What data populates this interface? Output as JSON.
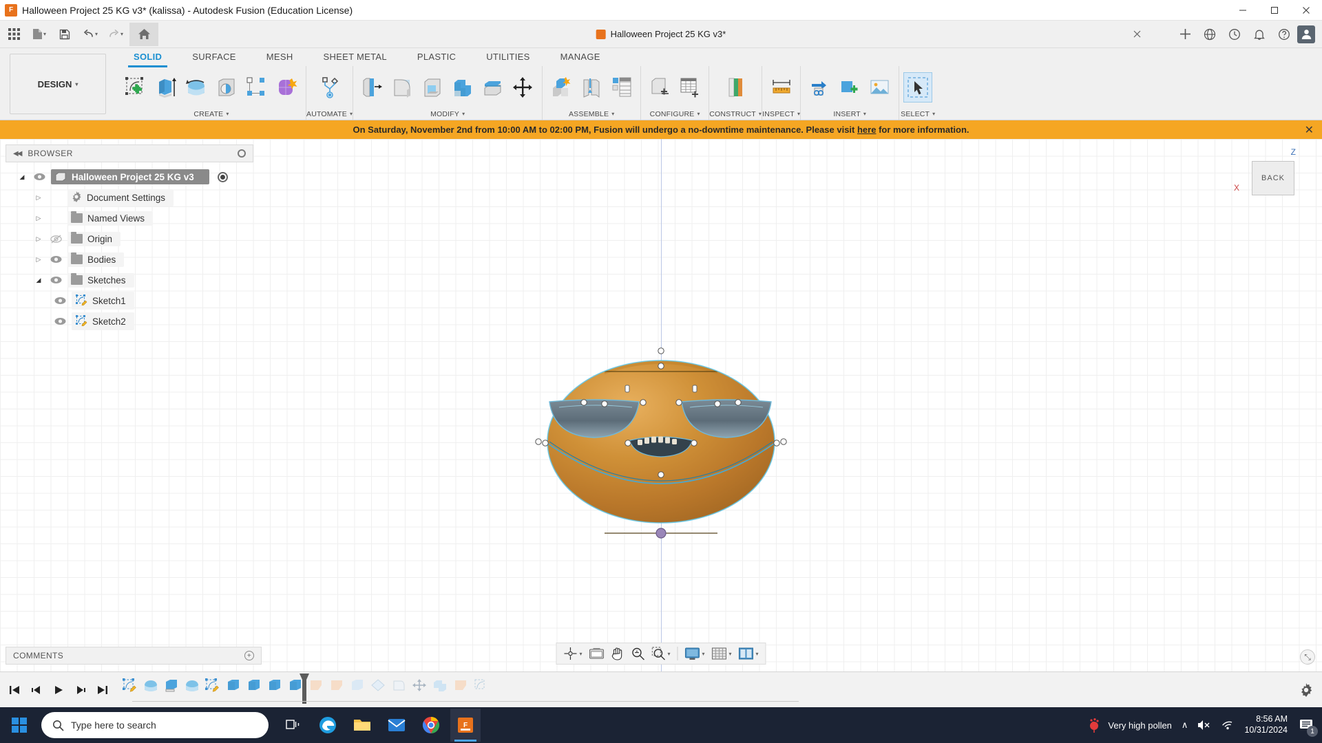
{
  "window": {
    "title": "Halloween Project 25 KG v3* (kalissa) - Autodesk Fusion (Education License)",
    "app_icon": "fusion-app-icon",
    "minimize": "—",
    "maximize": "☐",
    "close": "✕"
  },
  "quick_access": {
    "items": [
      {
        "name": "app-grid-button",
        "glyph": "grid"
      },
      {
        "name": "new-file-button",
        "glyph": "file",
        "caret": "▾"
      },
      {
        "name": "save-button",
        "glyph": "save"
      },
      {
        "name": "undo-button",
        "glyph": "undo",
        "caret": "▾"
      },
      {
        "name": "redo-button",
        "glyph": "redo",
        "caret": "▾"
      },
      {
        "name": "home-button",
        "glyph": "home"
      }
    ],
    "document_tab": {
      "label": "Halloween Project 25 KG v3*",
      "close": "✕"
    },
    "right_items": [
      {
        "name": "add-tab-button",
        "glyph": "plus"
      },
      {
        "name": "help-globe-button",
        "glyph": "globe"
      },
      {
        "name": "job-status-button",
        "glyph": "clock"
      },
      {
        "name": "notifications-button",
        "glyph": "bell"
      },
      {
        "name": "help-button",
        "glyph": "question"
      },
      {
        "name": "user-profile-avatar",
        "glyph": "user"
      }
    ]
  },
  "ribbon": {
    "workspace_label": "DESIGN",
    "workspace_caret": "▾",
    "tabs": [
      {
        "label": "SOLID",
        "active": true
      },
      {
        "label": "SURFACE",
        "active": false
      },
      {
        "label": "MESH",
        "active": false
      },
      {
        "label": "SHEET METAL",
        "active": false
      },
      {
        "label": "PLASTIC",
        "active": false
      },
      {
        "label": "UTILITIES",
        "active": false
      },
      {
        "label": "MANAGE",
        "active": false
      }
    ],
    "panels": [
      {
        "label": "CREATE",
        "caret": "▾",
        "tools": [
          "create-sketch",
          "extrude",
          "revolve",
          "hole",
          "pattern-rectangular",
          "form-create"
        ]
      },
      {
        "label": "AUTOMATE",
        "caret": "▾",
        "tools": [
          "automated-modeling"
        ]
      },
      {
        "label": "MODIFY",
        "caret": "▾",
        "tools": [
          "press-pull",
          "fillet",
          "shell",
          "combine",
          "offset-face",
          "move-copy"
        ]
      },
      {
        "label": "ASSEMBLE",
        "caret": "▾",
        "tools": [
          "new-component",
          "joint",
          "joint-origin"
        ]
      },
      {
        "label": "CONFIGURE",
        "caret": "▾",
        "tools": [
          "configure-component",
          "configuration-table"
        ]
      },
      {
        "label": "CONSTRUCT",
        "caret": "▾",
        "tools": [
          "offset-plane"
        ]
      },
      {
        "label": "INSPECT",
        "caret": "▾",
        "tools": [
          "measure"
        ]
      },
      {
        "label": "INSERT",
        "caret": "▾",
        "tools": [
          "insert-derive",
          "insert-mcmaster",
          "insert-decal"
        ]
      },
      {
        "label": "SELECT",
        "caret": "▾",
        "tools": [
          "select-cursor"
        ]
      }
    ]
  },
  "banner": {
    "text_before": "On Saturday, November 2nd from 10:00 AM to 02:00 PM, Fusion will undergo a no-downtime maintenance. Please visit ",
    "link": "here",
    "text_after": " for more information.",
    "close": "✕",
    "color": "#f5a623"
  },
  "browser": {
    "title": "BROWSER",
    "collapse_glyph": "◀◀",
    "tree": [
      {
        "label": "Halloween Project 25 KG v3",
        "depth": 0,
        "arrow": "open",
        "eye": "visible",
        "icon": "body-icon",
        "root": true,
        "radio": true
      },
      {
        "label": "Document Settings",
        "depth": 1,
        "arrow": "closed",
        "eye": "none",
        "icon": "gear-icon",
        "root": false,
        "radio": false
      },
      {
        "label": "Named Views",
        "depth": 1,
        "arrow": "closed",
        "eye": "none",
        "icon": "folder-icon",
        "root": false,
        "radio": false
      },
      {
        "label": "Origin",
        "depth": 1,
        "arrow": "closed",
        "eye": "hidden",
        "icon": "folder-icon",
        "root": false,
        "radio": false
      },
      {
        "label": "Bodies",
        "depth": 1,
        "arrow": "closed",
        "eye": "visible",
        "icon": "folder-icon",
        "root": false,
        "radio": false
      },
      {
        "label": "Sketches",
        "depth": 1,
        "arrow": "open",
        "eye": "visible",
        "icon": "folder-icon",
        "root": false,
        "radio": false
      },
      {
        "label": "Sketch1",
        "depth": 2,
        "arrow": "none",
        "eye": "visible",
        "icon": "sketch-icon",
        "root": false,
        "radio": false
      },
      {
        "label": "Sketch2",
        "depth": 2,
        "arrow": "none",
        "eye": "visible",
        "icon": "sketch-icon",
        "root": false,
        "radio": false
      }
    ]
  },
  "comments": {
    "label": "COMMENTS",
    "add_glyph": "+"
  },
  "viewcube": {
    "face_label": "BACK",
    "axis_z": "Z",
    "axis_x": "X"
  },
  "model": {
    "name": "pumpkin-jack-o-lantern",
    "body_color": "#c8862f",
    "sketch_color": "#6fb8d8"
  },
  "viewport_toolbar": {
    "items": [
      {
        "name": "orbit-tool",
        "glyph": "orbit",
        "caret": "▾"
      },
      {
        "name": "look-at-tool",
        "glyph": "lookat",
        "caret": ""
      },
      {
        "name": "pan-tool",
        "glyph": "pan",
        "caret": ""
      },
      {
        "name": "zoom-tool",
        "glyph": "zoom",
        "caret": ""
      },
      {
        "name": "fit-tool",
        "glyph": "fit",
        "caret": "▾"
      },
      {
        "name": "display-settings",
        "glyph": "display",
        "caret": "▾"
      },
      {
        "name": "grid-snaps",
        "glyph": "grid",
        "caret": "▾"
      },
      {
        "name": "viewports",
        "glyph": "viewports",
        "caret": "▾"
      }
    ],
    "grip": "⤡"
  },
  "timeline": {
    "nav": [
      {
        "name": "timeline-go-start",
        "glyph": "⏮"
      },
      {
        "name": "timeline-step-back",
        "glyph": "◀"
      },
      {
        "name": "timeline-play",
        "glyph": "▶"
      },
      {
        "name": "timeline-step-fwd",
        "glyph": "▶"
      },
      {
        "name": "timeline-go-end",
        "glyph": "⏭"
      }
    ],
    "features": [
      {
        "name": "timeline-sketch1",
        "type": "sketch",
        "state": "done"
      },
      {
        "name": "timeline-revolve1",
        "type": "revolve",
        "state": "done"
      },
      {
        "name": "timeline-extrude1",
        "type": "extrude",
        "state": "done"
      },
      {
        "name": "timeline-revolve2",
        "type": "revolve",
        "state": "done"
      },
      {
        "name": "timeline-sketch2",
        "type": "sketch",
        "state": "done"
      },
      {
        "name": "timeline-extrude2",
        "type": "extrude",
        "state": "done"
      },
      {
        "name": "timeline-extrude3",
        "type": "extrude",
        "state": "done"
      },
      {
        "name": "timeline-extrude4",
        "type": "extrude",
        "state": "done"
      },
      {
        "name": "timeline-extrude5",
        "type": "extrude",
        "state": "done"
      },
      {
        "name": "timeline-feature-10",
        "type": "suppressed-a",
        "state": "pending"
      },
      {
        "name": "timeline-feature-11",
        "type": "suppressed-a",
        "state": "pending"
      },
      {
        "name": "timeline-feature-12",
        "type": "extrude",
        "state": "pending"
      },
      {
        "name": "timeline-feature-13",
        "type": "fillet",
        "state": "pending"
      },
      {
        "name": "timeline-feature-14",
        "type": "shell",
        "state": "pending"
      },
      {
        "name": "timeline-feature-15",
        "type": "move",
        "state": "pending"
      },
      {
        "name": "timeline-feature-16",
        "type": "combine",
        "state": "pending"
      },
      {
        "name": "timeline-feature-17",
        "type": "suppressed-a",
        "state": "pending"
      },
      {
        "name": "timeline-feature-18",
        "type": "sketch",
        "state": "pending"
      }
    ],
    "settings_glyph": "⚙"
  },
  "taskbar": {
    "start_glyph": "windows-logo",
    "search_placeholder": "Type here to search",
    "apps": [
      {
        "name": "task-view-button",
        "glyph": "taskview",
        "active": false
      },
      {
        "name": "edge-taskbar-icon",
        "glyph": "edge",
        "active": false
      },
      {
        "name": "explorer-taskbar-icon",
        "glyph": "folder",
        "active": false
      },
      {
        "name": "mail-taskbar-icon",
        "glyph": "mail",
        "active": false
      },
      {
        "name": "chrome-taskbar-icon",
        "glyph": "chrome",
        "active": false
      },
      {
        "name": "fusion-taskbar-icon",
        "glyph": "fusion",
        "active": true
      }
    ],
    "weather_label": "Very high pollen",
    "tray": {
      "chevron": "∧",
      "volume": "🔇",
      "network": "wifi",
      "time": "8:56 AM",
      "date": "10/31/2024",
      "notification_count": "1"
    }
  }
}
